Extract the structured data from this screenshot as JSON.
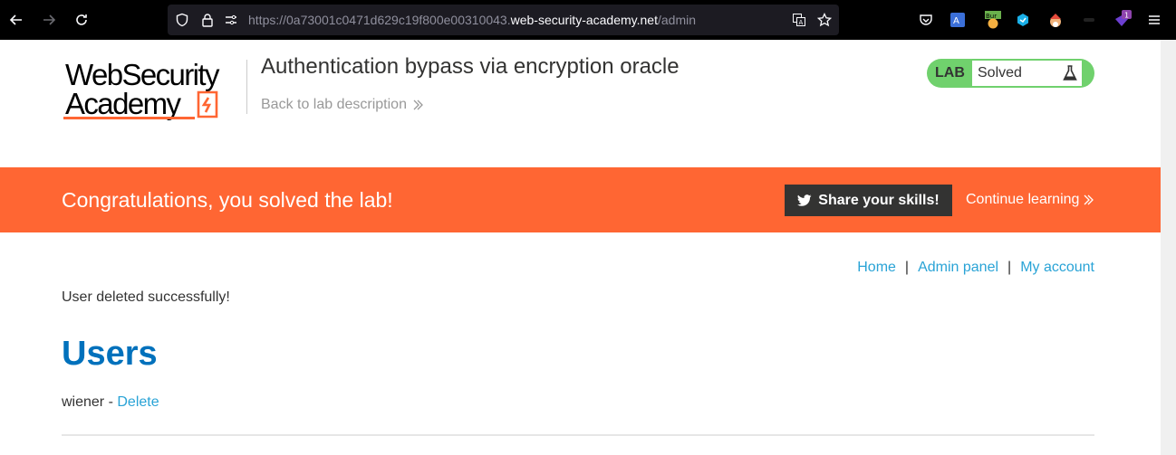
{
  "browser": {
    "url_prefix": "https://0a73001c0471d629c19f800e00310043.",
    "url_domain": "web-security-academy.net",
    "url_path": "/admin",
    "extensions": [
      "pocket-icon",
      "translate-icon",
      "burp-icon",
      "extension-blue-icon",
      "extension-santa-icon",
      "extension-dark-icon",
      "extension-purple-icon"
    ],
    "ext_badge": "1",
    "burp_label": "Bur"
  },
  "header": {
    "logo_line1": "WebSecurity",
    "logo_line2": "Academy",
    "lab_title": "Authentication bypass via encryption oracle",
    "back_link": "Back to lab description",
    "lab_badge_label": "LAB",
    "lab_status": "Solved"
  },
  "banner": {
    "text": "Congratulations, you solved the lab!",
    "share_label": "Share your skills!",
    "continue_label": "Continue learning"
  },
  "nav": {
    "home": "Home",
    "sep": "|",
    "admin": "Admin panel",
    "account": "My account"
  },
  "main": {
    "message": "User deleted successfully!",
    "heading": "Users",
    "users": [
      {
        "name": "wiener",
        "dash": " - ",
        "action": "Delete"
      }
    ]
  },
  "colors": {
    "accent": "#ff6633",
    "lab_green": "#70d16d",
    "link": "#29a3d6",
    "heading": "#0071bc"
  }
}
